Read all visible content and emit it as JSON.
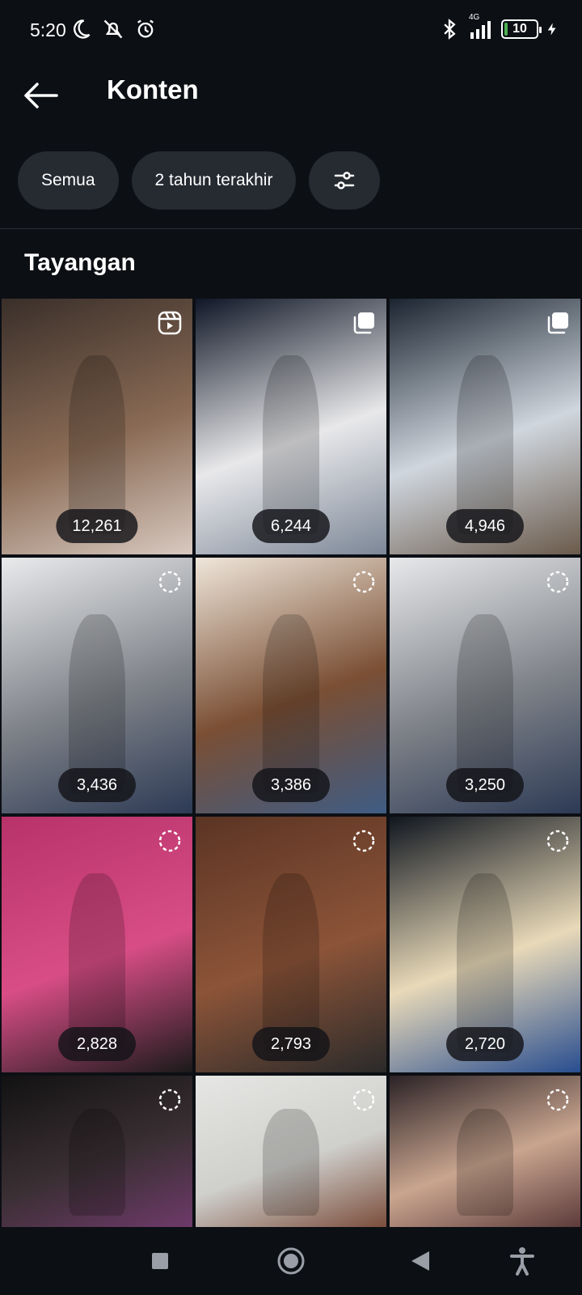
{
  "status_bar": {
    "time": "5:20",
    "network": "4G",
    "battery_level": "10",
    "battery_fraction": 0.1
  },
  "header": {
    "title": "Konten",
    "back_icon": "arrow-left-icon"
  },
  "filters": {
    "all_label": "Semua",
    "period_label": "2 tahun terakhir",
    "settings_icon": "sliders-icon"
  },
  "section": {
    "title": "Tayangan"
  },
  "posts": [
    {
      "views": "12,261",
      "type": "reel",
      "colors": [
        "#3a2f2a",
        "#8a6b55",
        "#d8c9c0"
      ]
    },
    {
      "views": "6,244",
      "type": "carousel",
      "colors": [
        "#0f1626",
        "#e8e8ea",
        "#7c8797"
      ]
    },
    {
      "views": "4,946",
      "type": "carousel",
      "colors": [
        "#1b2430",
        "#cfd6de",
        "#6a5a4b"
      ]
    },
    {
      "views": "3,436",
      "type": "story",
      "colors": [
        "#e9eaec",
        "#7e8288",
        "#2d3a55"
      ]
    },
    {
      "views": "3,386",
      "type": "story",
      "colors": [
        "#efe6da",
        "#7a4f34",
        "#3f5c84"
      ]
    },
    {
      "views": "3,250",
      "type": "story",
      "colors": [
        "#e7e8ea",
        "#7e8288",
        "#2d3a55"
      ]
    },
    {
      "views": "2,828",
      "type": "story",
      "colors": [
        "#b8326a",
        "#d84d86",
        "#1a1a1a"
      ]
    },
    {
      "views": "2,793",
      "type": "story",
      "colors": [
        "#5b3424",
        "#8c5438",
        "#2a2a2a"
      ]
    },
    {
      "views": "2,720",
      "type": "story",
      "colors": [
        "#10161f",
        "#e8d9b8",
        "#284d8f"
      ]
    },
    {
      "views": "",
      "type": "story",
      "colors": [
        "#121212",
        "#3a2f33",
        "#6e3a6a"
      ]
    },
    {
      "views": "",
      "type": "story",
      "colors": [
        "#e6e6e4",
        "#cfcfcc",
        "#7a4c3a"
      ]
    },
    {
      "views": "",
      "type": "story",
      "colors": [
        "#2b2226",
        "#c9a58f",
        "#5b3a3a"
      ]
    }
  ],
  "nav": {
    "recent_icon": "square-icon",
    "home_icon": "circle-icon",
    "back_icon": "triangle-back-icon",
    "accessibility_icon": "accessibility-icon"
  }
}
